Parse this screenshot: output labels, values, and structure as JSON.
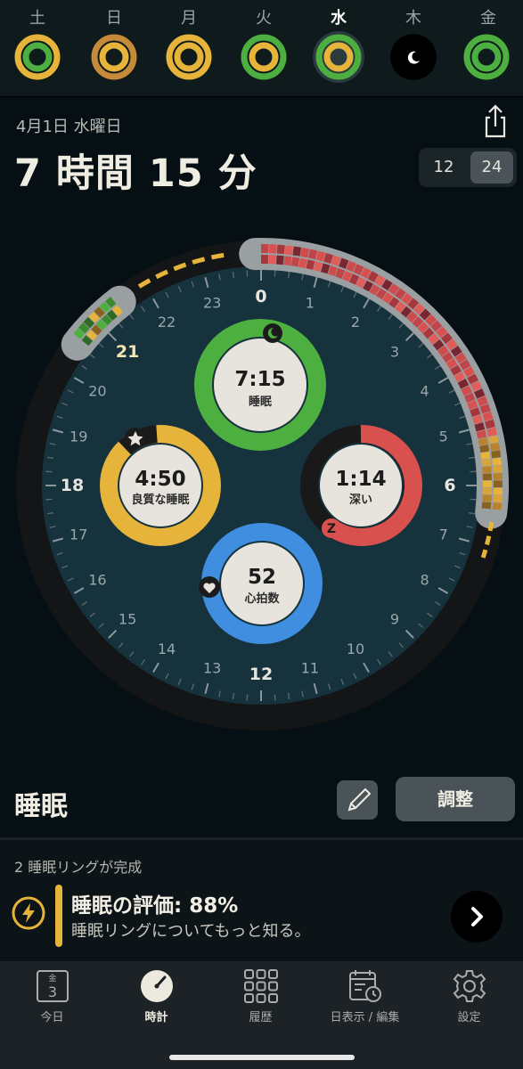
{
  "week": {
    "days": [
      {
        "label": "土",
        "bold": false
      },
      {
        "label": "日",
        "bold": false
      },
      {
        "label": "月",
        "bold": false
      },
      {
        "label": "火",
        "bold": false
      },
      {
        "label": "水",
        "bold": true
      },
      {
        "label": "木",
        "bold": false
      },
      {
        "label": "金",
        "bold": false
      }
    ]
  },
  "header": {
    "date": "4月1日 水曜日",
    "duration": "7 時間 15 分",
    "format_options": [
      "12",
      "24"
    ],
    "selected_format": "24"
  },
  "clock": {
    "hour_labels": [
      "0",
      "1",
      "2",
      "3",
      "4",
      "5",
      "6",
      "7",
      "8",
      "9",
      "10",
      "11",
      "12",
      "13",
      "14",
      "15",
      "16",
      "17",
      "18",
      "19",
      "20",
      "21",
      "22",
      "23"
    ],
    "marked_hour": "21",
    "rings": {
      "sleep": {
        "value": "7:15",
        "label": "睡眠",
        "color": "#4caf3f",
        "icon": "moon-icon"
      },
      "quality": {
        "value": "4:50",
        "label": "良質な睡眠",
        "color": "#e6b43a",
        "icon": "star-icon"
      },
      "deep": {
        "value": "1:14",
        "label": "深い",
        "color": "#d9514f",
        "icon": "z-icon"
      },
      "heart": {
        "value": "52",
        "label": "心拍数",
        "color": "#3f8ee0",
        "icon": "heart-icon"
      }
    }
  },
  "sleep_section": {
    "title": "睡眠",
    "adjust_label": "調整"
  },
  "rating": {
    "rings_completed": "2 睡眠リングが完成",
    "title": "睡眠の評価: 88%",
    "subtitle": "睡眠リングについてもっと知る。"
  },
  "tabs": [
    {
      "label": "今日",
      "icon": "calendar-icon",
      "icon_day": "金",
      "icon_date": "3",
      "active": false
    },
    {
      "label": "時計",
      "icon": "clock-icon",
      "active": true
    },
    {
      "label": "履歴",
      "icon": "grid-icon",
      "active": false
    },
    {
      "label": "日表示 / 編集",
      "icon": "calendar-clock-icon",
      "active": false
    },
    {
      "label": "設定",
      "icon": "gear-icon",
      "active": false
    }
  ],
  "colors": {
    "background": "#061014",
    "dial": "#16323d",
    "sleep_green": "#4caf3f",
    "quality_yellow": "#e6b43a",
    "deep_red": "#d9514f",
    "heart_blue": "#3f8ee0"
  }
}
